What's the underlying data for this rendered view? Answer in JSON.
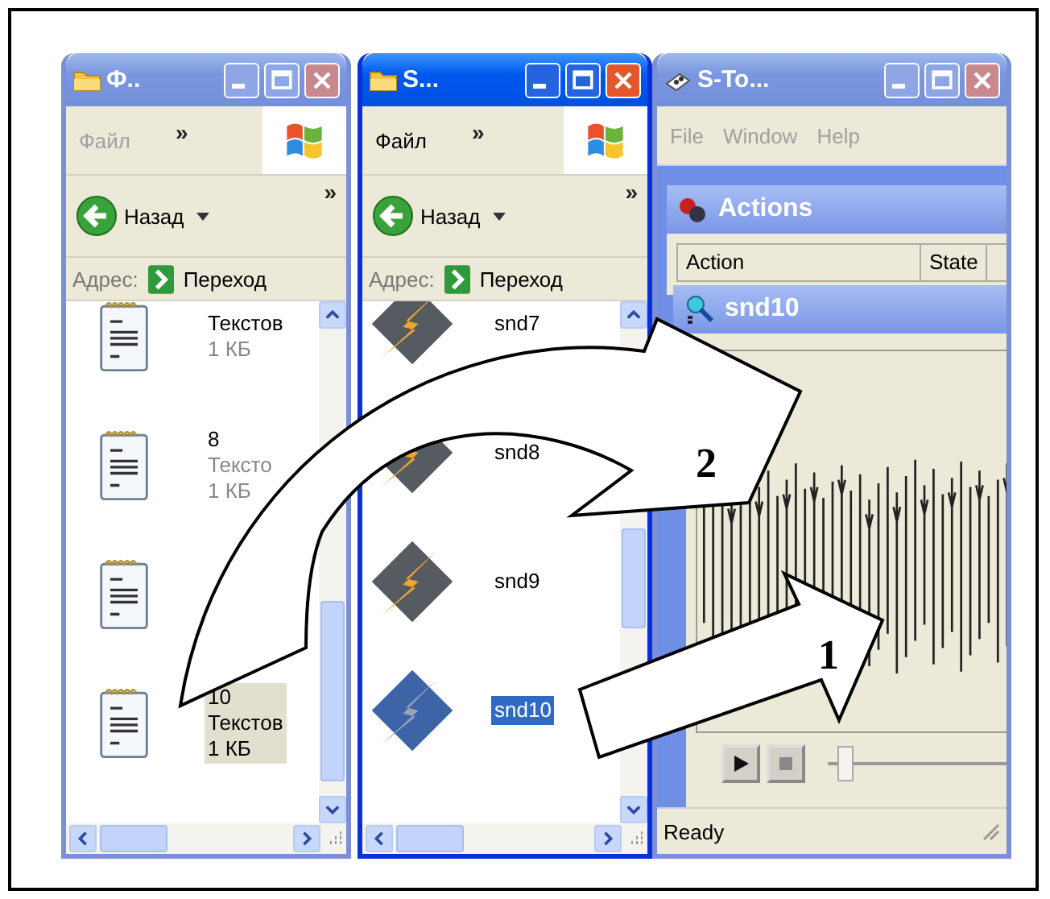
{
  "windows": [
    {
      "kind": "explorer",
      "active": false,
      "title": "Ф..",
      "menu": [
        "Файл"
      ],
      "menu_more": "»",
      "back_label": "Назад",
      "toolbar_more": "»",
      "address_label": "Адрес:",
      "go_label": "Переход",
      "files": [
        {
          "kind": "text",
          "selected": false,
          "lines": [
            "Текстов",
            "1 КБ"
          ]
        },
        {
          "kind": "text",
          "selected": false,
          "lines": [
            "8",
            "Тексто",
            "1 КБ"
          ]
        },
        {
          "kind": "text",
          "selected": false
        },
        {
          "kind": "text",
          "selected": true,
          "lines": [
            "10",
            "Текстов",
            "1 КБ"
          ]
        }
      ]
    },
    {
      "kind": "explorer",
      "active": true,
      "title": "S...",
      "menu": [
        "Файл"
      ],
      "menu_more": "»",
      "back_label": "Назад",
      "toolbar_more": "»",
      "address_label": "Адрес:",
      "go_label": "Переход",
      "files": [
        {
          "kind": "sound",
          "selected": false,
          "lines": [
            "snd7"
          ]
        },
        {
          "kind": "sound",
          "selected": false,
          "lines": [
            "snd8"
          ]
        },
        {
          "kind": "sound",
          "selected": false,
          "lines": [
            "snd9"
          ]
        },
        {
          "kind": "sound",
          "selected": true,
          "lines": [
            "snd10"
          ]
        }
      ]
    },
    {
      "kind": "player",
      "active": false,
      "title": "S-To...",
      "menu": [
        "File",
        "Window",
        "Help"
      ],
      "panel_title": "Actions",
      "columns": [
        "Action",
        "State"
      ],
      "document_title": "snd10",
      "slider": {
        "level": 0.05
      },
      "status": "Ready"
    }
  ],
  "arrows": [
    {
      "label": "2"
    },
    {
      "label": "1"
    }
  ]
}
